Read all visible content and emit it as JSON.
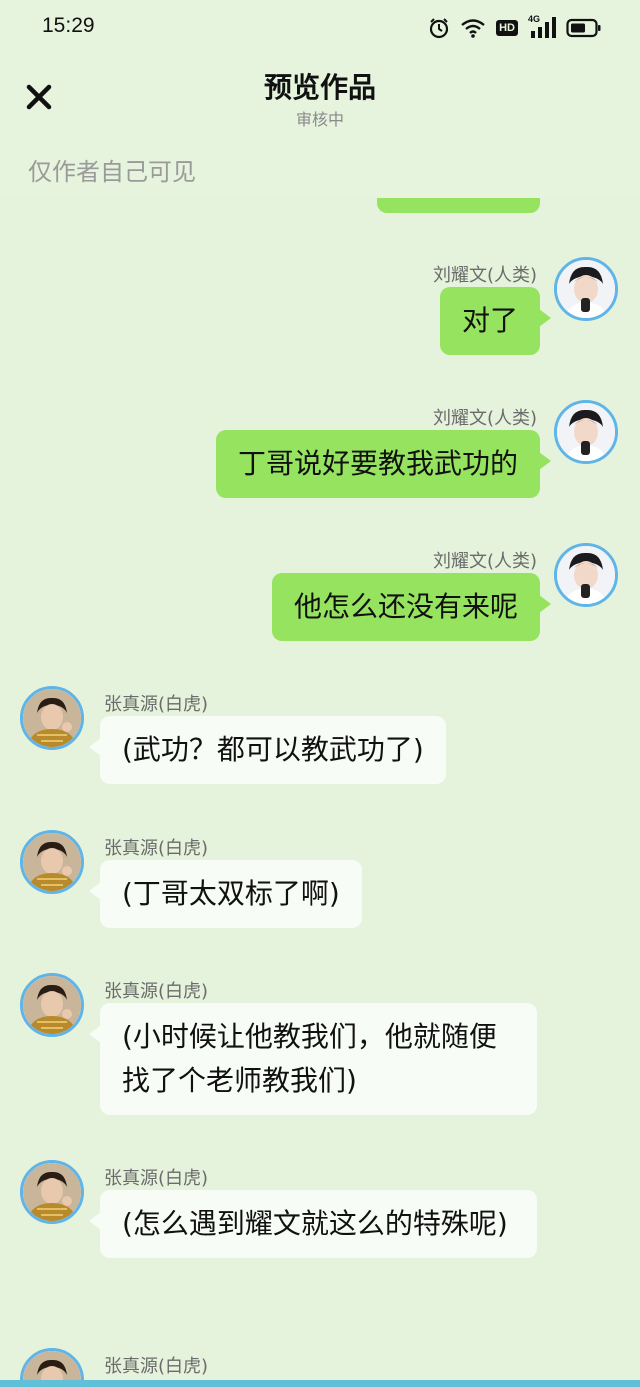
{
  "status_bar": {
    "time": "15:29",
    "icons": [
      "alarm-icon",
      "wifi-icon",
      "hd-icon",
      "signal-4g-icon",
      "battery-icon"
    ],
    "hd_label": "HD",
    "network_label": "4G"
  },
  "header": {
    "title": "预览作品",
    "subtitle": "审核中",
    "close_icon": "close-icon"
  },
  "visibility_note": "仅作者自己可见",
  "colors": {
    "background": "#e5f3dc",
    "bubble_self": "#95e35f",
    "bubble_other": "#f8fcf6",
    "avatar_ring": "#5fb4e8"
  },
  "messages": [
    {
      "side": "right",
      "sender": "刘耀文(人类)",
      "text": "对了"
    },
    {
      "side": "right",
      "sender": "刘耀文(人类)",
      "text": "丁哥说好要教我武功的"
    },
    {
      "side": "right",
      "sender": "刘耀文(人类)",
      "text": "他怎么还没有来呢"
    },
    {
      "side": "left",
      "sender": "张真源(白虎)",
      "text": "(武功？都可以教武功了)"
    },
    {
      "side": "left",
      "sender": "张真源(白虎)",
      "text": "(丁哥太双标了啊)"
    },
    {
      "side": "left",
      "sender": "张真源(白虎)",
      "text": "(小时候让他教我们，他就随便找了个老师教我们)"
    },
    {
      "side": "left",
      "sender": "张真源(白虎)",
      "text": "(怎么遇到耀文就这么的特殊呢)"
    },
    {
      "side": "left",
      "sender": "张真源(白虎)",
      "text": ""
    }
  ]
}
